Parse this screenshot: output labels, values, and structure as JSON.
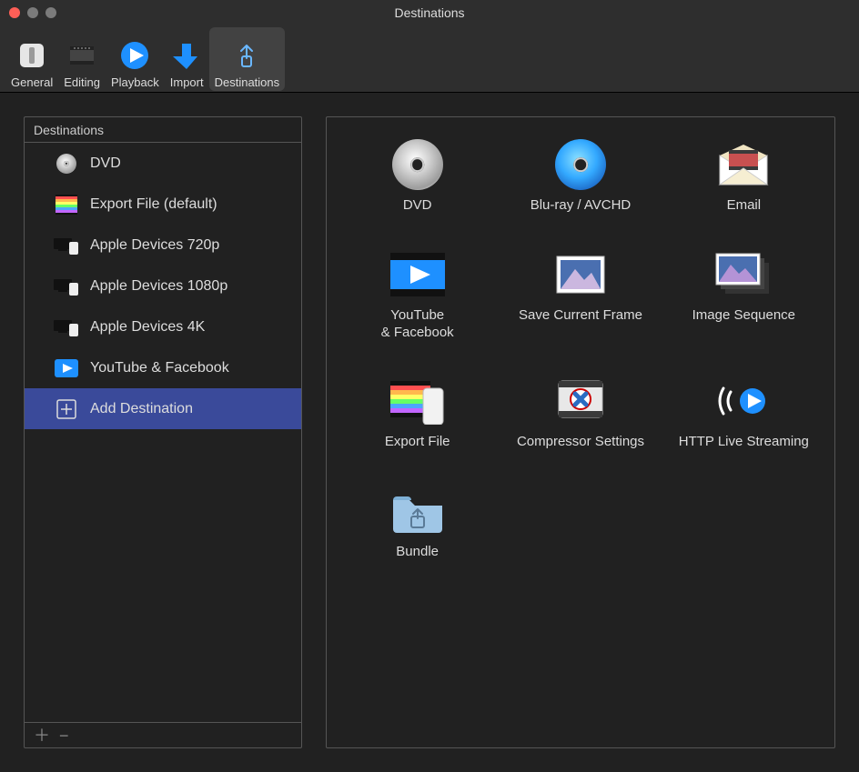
{
  "window": {
    "title": "Destinations"
  },
  "toolbar": {
    "items": [
      {
        "id": "general",
        "label": "General",
        "icon": "prefs-general-icon",
        "selected": false
      },
      {
        "id": "editing",
        "label": "Editing",
        "icon": "prefs-editing-icon",
        "selected": false
      },
      {
        "id": "playback",
        "label": "Playback",
        "icon": "prefs-playback-icon",
        "selected": false
      },
      {
        "id": "import",
        "label": "Import",
        "icon": "prefs-import-icon",
        "selected": false
      },
      {
        "id": "destinations",
        "label": "Destinations",
        "icon": "prefs-destinations-icon",
        "selected": true
      }
    ]
  },
  "sidebar": {
    "header": "Destinations",
    "items": [
      {
        "id": "dvd",
        "label": "DVD",
        "icon": "disc-silver-icon"
      },
      {
        "id": "export-file",
        "label": "Export File (default)",
        "icon": "filmstrip-rainbow-icon"
      },
      {
        "id": "apple-720p",
        "label": "Apple Devices 720p",
        "icon": "device-icon"
      },
      {
        "id": "apple-1080p",
        "label": "Apple Devices 1080p",
        "icon": "device-icon"
      },
      {
        "id": "apple-4k",
        "label": "Apple Devices 4K",
        "icon": "device-icon"
      },
      {
        "id": "youtube-fb",
        "label": "YouTube & Facebook",
        "icon": "youtube-play-icon"
      },
      {
        "id": "add-destination",
        "label": "Add Destination",
        "icon": "plus-box-icon",
        "selected": true
      }
    ]
  },
  "gallery": {
    "items": [
      {
        "id": "dvd",
        "label": "DVD",
        "icon": "disc-silver-icon"
      },
      {
        "id": "bluray",
        "label": "Blu-ray / AVCHD",
        "icon": "disc-blue-icon"
      },
      {
        "id": "email",
        "label": "Email",
        "icon": "envelope-icon"
      },
      {
        "id": "youtube",
        "label": "YouTube\n& Facebook",
        "icon": "youtube-play-icon"
      },
      {
        "id": "saveframe",
        "label": "Save Current Frame",
        "icon": "mountain-photo-icon"
      },
      {
        "id": "imageseq",
        "label": "Image Sequence",
        "icon": "mountain-stack-icon"
      },
      {
        "id": "export",
        "label": "Export File",
        "icon": "filmstrip-phone-icon"
      },
      {
        "id": "compr",
        "label": "Compressor Settings",
        "icon": "compressor-icon"
      },
      {
        "id": "hls",
        "label": "HTTP Live Streaming",
        "icon": "hls-icon"
      },
      {
        "id": "bundle",
        "label": "Bundle",
        "icon": "folder-share-icon"
      }
    ]
  }
}
